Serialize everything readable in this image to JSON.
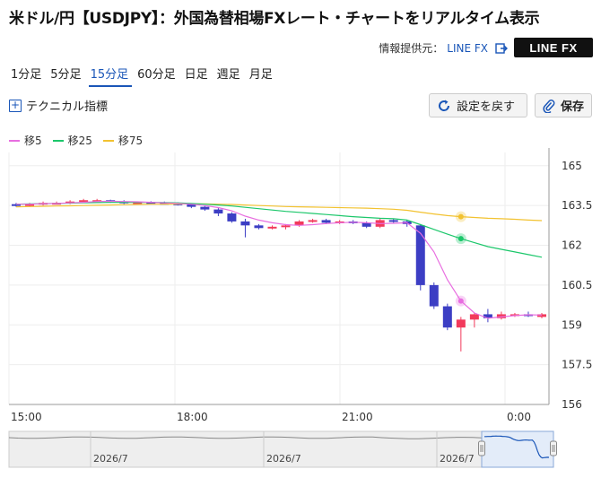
{
  "title": "米ドル/円【USDJPY】：外国為替相場FXレート・チャートをリアルタイム表示",
  "provider": {
    "label": "情報提供元：",
    "link": "LINE FX",
    "logo": "LINE FX"
  },
  "tabs": [
    {
      "label": "1分足",
      "active": false
    },
    {
      "label": "5分足",
      "active": false
    },
    {
      "label": "15分足",
      "active": true
    },
    {
      "label": "60分足",
      "active": false
    },
    {
      "label": "日足",
      "active": false
    },
    {
      "label": "週足",
      "active": false
    },
    {
      "label": "月足",
      "active": false
    }
  ],
  "technical_label": "テクニカル指標",
  "buttons": {
    "reset": "設定を戻す",
    "save": "保存"
  },
  "colors": {
    "ma5": "#e86ee0",
    "ma25": "#1cc76b",
    "ma75": "#f2c230",
    "up": "#f23a5c",
    "down": "#3c3ec4",
    "accent": "#1a56b8"
  },
  "chart_data": {
    "type": "candlestick",
    "legend": [
      {
        "name": "移5",
        "color": "#e86ee0"
      },
      {
        "name": "移25",
        "color": "#1cc76b"
      },
      {
        "name": "移75",
        "color": "#f2c230"
      }
    ],
    "ylim": [
      156,
      165.5
    ],
    "y_ticks": [
      "165",
      "163.5",
      "162",
      "160.5",
      "159",
      "157.5",
      "156"
    ],
    "x_ticks": [
      "15:00",
      "18:00",
      "21:00",
      "0:00"
    ],
    "candles": [
      {
        "o": 163.55,
        "h": 163.6,
        "l": 163.45,
        "c": 163.5
      },
      {
        "o": 163.5,
        "h": 163.6,
        "l": 163.45,
        "c": 163.55
      },
      {
        "o": 163.55,
        "h": 163.65,
        "l": 163.5,
        "c": 163.6
      },
      {
        "o": 163.6,
        "h": 163.65,
        "l": 163.55,
        "c": 163.6
      },
      {
        "o": 163.6,
        "h": 163.7,
        "l": 163.55,
        "c": 163.65
      },
      {
        "o": 163.65,
        "h": 163.75,
        "l": 163.6,
        "c": 163.7
      },
      {
        "o": 163.7,
        "h": 163.75,
        "l": 163.65,
        "c": 163.7
      },
      {
        "o": 163.7,
        "h": 163.72,
        "l": 163.6,
        "c": 163.65
      },
      {
        "o": 163.65,
        "h": 163.7,
        "l": 163.55,
        "c": 163.6
      },
      {
        "o": 163.6,
        "h": 163.65,
        "l": 163.55,
        "c": 163.62
      },
      {
        "o": 163.62,
        "h": 163.66,
        "l": 163.58,
        "c": 163.6
      },
      {
        "o": 163.6,
        "h": 163.65,
        "l": 163.55,
        "c": 163.58
      },
      {
        "o": 163.58,
        "h": 163.62,
        "l": 163.5,
        "c": 163.55
      },
      {
        "o": 163.55,
        "h": 163.58,
        "l": 163.4,
        "c": 163.45
      },
      {
        "o": 163.45,
        "h": 163.5,
        "l": 163.3,
        "c": 163.35
      },
      {
        "o": 163.35,
        "h": 163.4,
        "l": 163.1,
        "c": 163.2
      },
      {
        "o": 163.2,
        "h": 163.25,
        "l": 162.85,
        "c": 162.9
      },
      {
        "o": 162.9,
        "h": 163.0,
        "l": 162.3,
        "c": 162.75
      },
      {
        "o": 162.75,
        "h": 162.8,
        "l": 162.6,
        "c": 162.65
      },
      {
        "o": 162.65,
        "h": 162.75,
        "l": 162.6,
        "c": 162.7
      },
      {
        "o": 162.7,
        "h": 162.8,
        "l": 162.6,
        "c": 162.75
      },
      {
        "o": 162.75,
        "h": 162.95,
        "l": 162.7,
        "c": 162.9
      },
      {
        "o": 162.9,
        "h": 163.0,
        "l": 162.85,
        "c": 162.95
      },
      {
        "o": 162.95,
        "h": 163.0,
        "l": 162.8,
        "c": 162.85
      },
      {
        "o": 162.85,
        "h": 162.95,
        "l": 162.8,
        "c": 162.9
      },
      {
        "o": 162.9,
        "h": 162.95,
        "l": 162.8,
        "c": 162.85
      },
      {
        "o": 162.85,
        "h": 162.9,
        "l": 162.65,
        "c": 162.7
      },
      {
        "o": 162.7,
        "h": 163.0,
        "l": 162.65,
        "c": 162.95
      },
      {
        "o": 162.95,
        "h": 163.0,
        "l": 162.85,
        "c": 162.9
      },
      {
        "o": 162.9,
        "h": 162.95,
        "l": 162.7,
        "c": 162.8
      },
      {
        "o": 162.75,
        "h": 162.8,
        "l": 160.3,
        "c": 160.5
      },
      {
        "o": 160.5,
        "h": 160.6,
        "l": 159.6,
        "c": 159.7
      },
      {
        "o": 159.7,
        "h": 159.8,
        "l": 158.8,
        "c": 158.9
      },
      {
        "o": 158.9,
        "h": 159.3,
        "l": 158.0,
        "c": 159.2
      },
      {
        "o": 159.2,
        "h": 159.45,
        "l": 158.9,
        "c": 159.4
      },
      {
        "o": 159.4,
        "h": 159.6,
        "l": 159.1,
        "c": 159.25
      },
      {
        "o": 159.25,
        "h": 159.5,
        "l": 159.2,
        "c": 159.4
      },
      {
        "o": 159.35,
        "h": 159.45,
        "l": 159.3,
        "c": 159.4
      },
      {
        "o": 159.4,
        "h": 159.5,
        "l": 159.3,
        "c": 159.35
      },
      {
        "o": 159.3,
        "h": 159.45,
        "l": 159.25,
        "c": 159.4
      }
    ],
    "ma5": [
      163.55,
      163.55,
      163.57,
      163.58,
      163.6,
      163.62,
      163.65,
      163.66,
      163.65,
      163.64,
      163.62,
      163.6,
      163.58,
      163.55,
      163.5,
      163.42,
      163.3,
      163.1,
      162.95,
      162.85,
      162.78,
      162.75,
      162.78,
      162.82,
      162.85,
      162.87,
      162.85,
      162.82,
      162.83,
      162.85,
      162.45,
      161.75,
      160.7,
      159.9,
      159.45,
      159.25,
      159.3,
      159.35,
      159.38,
      159.37
    ],
    "ma25": [
      163.55,
      163.56,
      163.57,
      163.58,
      163.59,
      163.6,
      163.61,
      163.62,
      163.62,
      163.62,
      163.62,
      163.61,
      163.6,
      163.58,
      163.55,
      163.52,
      163.48,
      163.43,
      163.38,
      163.33,
      163.28,
      163.24,
      163.2,
      163.16,
      163.12,
      163.08,
      163.05,
      163.02,
      163.0,
      162.95,
      162.78,
      162.6,
      162.42,
      162.25,
      162.1,
      161.95,
      161.85,
      161.75,
      161.65,
      161.55
    ],
    "ma75": [
      163.45,
      163.46,
      163.47,
      163.48,
      163.49,
      163.5,
      163.51,
      163.52,
      163.53,
      163.54,
      163.55,
      163.55,
      163.56,
      163.56,
      163.56,
      163.55,
      163.54,
      163.52,
      163.5,
      163.48,
      163.46,
      163.45,
      163.44,
      163.43,
      163.42,
      163.41,
      163.4,
      163.38,
      163.36,
      163.32,
      163.25,
      163.18,
      163.12,
      163.08,
      163.05,
      163.02,
      163.0,
      162.98,
      162.95,
      162.93
    ],
    "navigator_labels": [
      "2026/7",
      "2026/7",
      "2026/7"
    ]
  }
}
